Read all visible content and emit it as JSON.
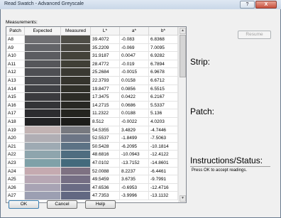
{
  "window": {
    "title": "Read Swatch - Advanced Greyscale",
    "help_glyph": "?",
    "close_glyph": "X"
  },
  "measurements_label": "Measurements:",
  "columns": [
    "Patch",
    "Expected",
    "Measured",
    "L*",
    "a*",
    "b*"
  ],
  "rows": [
    {
      "patch": "A8",
      "expected": "#6f6f72",
      "measured": "#4f4e47",
      "L": "39.4072",
      "a": "-0.083",
      "b": "6.8368"
    },
    {
      "patch": "A9",
      "expected": "#636468",
      "measured": "#47463f",
      "L": "35.2209",
      "a": "-0.069",
      "b": "7.0095"
    },
    {
      "patch": "A10",
      "expected": "#5b5c60",
      "measured": "#434239",
      "L": "31.9187",
      "a": "0.0047",
      "b": "6.9282"
    },
    {
      "patch": "A11",
      "expected": "#55565a",
      "measured": "#403f36",
      "L": "28.4772",
      "a": "-0.019",
      "b": "6.7894"
    },
    {
      "patch": "A12",
      "expected": "#4e4f53",
      "measured": "#3a3932",
      "L": "25.2684",
      "a": "-0.0015",
      "b": "6.9678"
    },
    {
      "patch": "A13",
      "expected": "#47484c",
      "measured": "#35342d",
      "L": "22.3793",
      "a": "0.0158",
      "b": "6.6712"
    },
    {
      "patch": "A14",
      "expected": "#404145",
      "measured": "#303029",
      "L": "19.8477",
      "a": "0.0856",
      "b": "6.5515"
    },
    {
      "patch": "A15",
      "expected": "#3a3a3e",
      "measured": "#2c2c26",
      "L": "17.3475",
      "a": "0.0422",
      "b": "6.2167"
    },
    {
      "patch": "A16",
      "expected": "#333437",
      "measured": "#282823",
      "L": "14.2715",
      "a": "0.0686",
      "b": "5.5337"
    },
    {
      "patch": "A17",
      "expected": "#2c2c2f",
      "measured": "#24241f",
      "L": "11.2322",
      "a": "0.0188",
      "b": "5.136"
    },
    {
      "patch": "A18",
      "expected": "#222224",
      "measured": "#1c1c19",
      "L": "8.512",
      "a": "-0.0022",
      "b": "4.0203"
    },
    {
      "patch": "A19",
      "expected": "#c2b3b3",
      "measured": "#77797f",
      "L": "54.5355",
      "a": "3.4829",
      "b": "-4.7446"
    },
    {
      "patch": "A20",
      "expected": "#b0aeb4",
      "measured": "#6c7585",
      "L": "52.5537",
      "a": "-1.8499",
      "b": "-7.5063"
    },
    {
      "patch": "A21",
      "expected": "#9eaab3",
      "measured": "#5c7285",
      "L": "50.5428",
      "a": "-6.2095",
      "b": "-10.1814"
    },
    {
      "patch": "A22",
      "expected": "#8ea5ad",
      "measured": "#4f6d80",
      "L": "48.6816",
      "a": "-10.0943",
      "b": "-12.4122"
    },
    {
      "patch": "A23",
      "expected": "#7fa1a8",
      "measured": "#436a7c",
      "L": "47.0102",
      "a": "-13.7152",
      "b": "-14.8601"
    },
    {
      "patch": "A24",
      "expected": "#c5aab0",
      "measured": "#7e7182",
      "L": "52.0088",
      "a": "8.2237",
      "b": "-6.4461"
    },
    {
      "patch": "A25",
      "expected": "#b7a7b4",
      "measured": "#756e84",
      "L": "49.5459",
      "a": "3.6735",
      "b": "-9.7991"
    },
    {
      "patch": "A26",
      "expected": "#a8a3b4",
      "measured": "#6a6b84",
      "L": "47.6536",
      "a": "-0.6953",
      "b": "-12.4716"
    },
    {
      "patch": "A27",
      "expected": "#9c9fb2",
      "measured": "#626882",
      "L": "47.7353",
      "a": "-3.9996",
      "b": "-13.1132"
    }
  ],
  "buttons": {
    "resume": "Resume",
    "ok": "OK",
    "cancel": "Cancel",
    "help": "Help"
  },
  "strip_label": "Strip:",
  "patch_label": "Patch:",
  "instructions_label": "Instructions/Status:",
  "instructions_text": "Press OK to accept readings."
}
